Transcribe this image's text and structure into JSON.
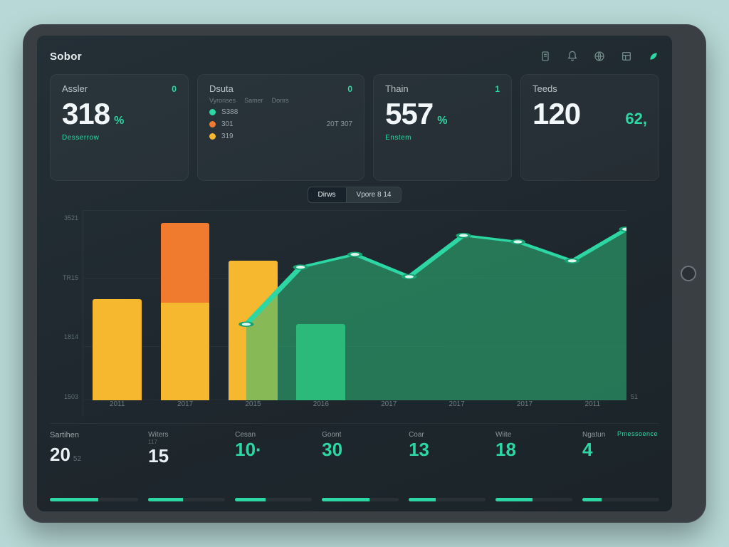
{
  "app": {
    "title": "Sobor"
  },
  "header_icons": [
    "doc-icon",
    "bell-icon",
    "globe-icon",
    "layout-icon",
    "leaf-icon"
  ],
  "cards": {
    "assler": {
      "title": "Assler",
      "badge": "0",
      "value": "318",
      "unit": "%",
      "footer": "Desserrow"
    },
    "dsuta": {
      "title": "Dsuta",
      "badge": "0",
      "subs": [
        "Vyronses",
        "Samer",
        "Donrs"
      ],
      "legend": [
        {
          "label": "S388",
          "value": "",
          "color": "#2cd7a4"
        },
        {
          "label": "301",
          "value": "20T 307",
          "color": "#f07a2e"
        },
        {
          "label": "319",
          "value": "",
          "color": "#f5b82e"
        }
      ]
    },
    "thain": {
      "title": "Thain",
      "badge": "1",
      "value": "557",
      "unit": "%",
      "footer": "Enstem"
    },
    "teeds": {
      "title": "Teeds",
      "value": "120",
      "extra": "62,"
    }
  },
  "segmented": {
    "options": [
      "Dirws",
      "Vpore 8 14"
    ],
    "active": 0
  },
  "chart_data": {
    "type": "bar+line",
    "categories": [
      "2011",
      "2017",
      "2015",
      "2016",
      "2017",
      "2017",
      "2017",
      "2011"
    ],
    "y_ticks_left": [
      "3521",
      "TR15",
      "1814",
      "1503"
    ],
    "y_ticks_right": [
      "",
      "",
      "",
      "51"
    ],
    "bars": {
      "values": [
        160,
        280,
        220,
        120,
        0,
        0,
        0,
        0
      ],
      "colors": [
        "#f5b82e",
        "#f28a2d",
        "#f5b82e",
        "#2cba7a",
        "",
        "",
        "",
        ""
      ]
    },
    "line": {
      "name": "trend",
      "color": "#2cd7a4",
      "values": [
        null,
        null,
        null,
        120,
        210,
        230,
        195,
        260,
        250,
        220,
        270
      ]
    }
  },
  "bottom": {
    "section_title": "Sartihen",
    "section_tag": "Pmessoence",
    "items": [
      {
        "title": "",
        "sub": "",
        "value": "20",
        "extra": "52",
        "green": false,
        "progress": 55
      },
      {
        "title": "Witers",
        "sub": "117",
        "value": "15",
        "extra": "",
        "green": false,
        "progress": 45
      },
      {
        "title": "Cesan",
        "sub": "",
        "value": "10·",
        "extra": "",
        "green": true,
        "progress": 40
      },
      {
        "title": "Goont",
        "sub": "",
        "value": "30",
        "extra": "",
        "green": true,
        "progress": 62
      },
      {
        "title": "Coar",
        "sub": "",
        "value": "13",
        "extra": "",
        "green": true,
        "progress": 35
      },
      {
        "title": "Wiite",
        "sub": "",
        "value": "18",
        "extra": "",
        "green": true,
        "progress": 48
      },
      {
        "title": "Ngatun",
        "sub": "",
        "value": "4",
        "extra": "",
        "green": true,
        "progress": 25
      }
    ]
  },
  "colors": {
    "accent": "#2cd7a4",
    "orange": "#f28a2d",
    "amber": "#f5b82e",
    "green": "#2cba7a"
  }
}
